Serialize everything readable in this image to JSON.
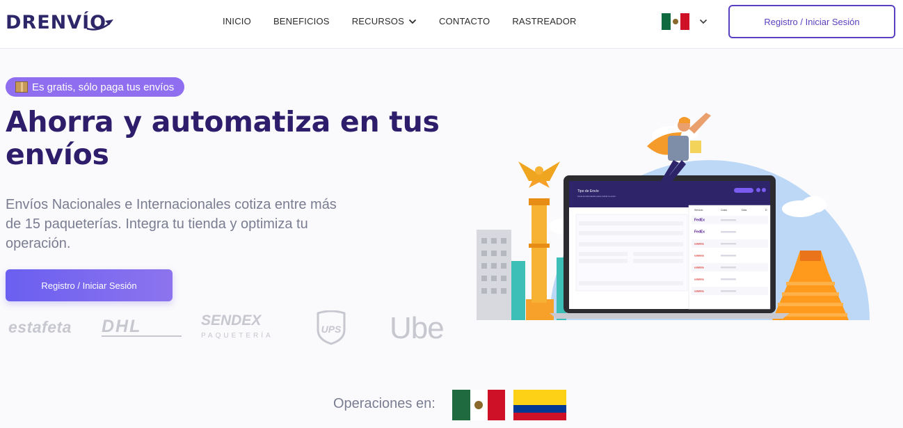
{
  "header": {
    "logo": "DRENVÍO",
    "nav": [
      {
        "label": "INICIO"
      },
      {
        "label": "BENEFICIOS"
      },
      {
        "label": "RECURSOS"
      },
      {
        "label": "CONTACTO"
      },
      {
        "label": "RASTREADOR"
      }
    ],
    "country_flag": "mexico-flag",
    "cta_label": "Registro / Iniciar Sesión"
  },
  "hero": {
    "badge": "Es gratis, sólo paga tus envíos",
    "title": "Ahorra y automatiza en tus envíos",
    "subtitle": "Envíos Nacionales e Internacionales cotiza entre más de 15 paqueterías. Integra tu tienda y optimiza tu operación.",
    "cta_label": "Registro / Iniciar Sesión"
  },
  "carriers": [
    "estafeta",
    "DHL",
    "SENDEX",
    "PAQUETERÍA",
    "UPS",
    "Ube"
  ],
  "operations": {
    "label": "Operaciones en:",
    "flags": [
      "mexico-flag",
      "colombia-flag"
    ]
  },
  "mockup": {
    "panel_title": "Tipo de Envío",
    "panel_subtitle": "Llena la información para cotizar tu envío",
    "table_headers": [
      "Servicio",
      "Costo",
      "Días",
      "D"
    ],
    "rows": [
      {
        "carrier": "FedEx",
        "color": "#4d148c"
      },
      {
        "carrier": "FedEx",
        "color": "#4d148c"
      },
      {
        "carrier": "estafeta",
        "color": "#d8312b"
      },
      {
        "carrier": "estafeta",
        "color": "#d8312b"
      },
      {
        "carrier": "estafeta",
        "color": "#d8312b"
      },
      {
        "carrier": "estafeta",
        "color": "#d8312b"
      },
      {
        "carrier": "estafeta",
        "color": "#d8312b"
      }
    ]
  },
  "colors": {
    "brand": "#2d1d6b",
    "accent": "#5a3fc0",
    "badge": "#8f6ef0",
    "muted": "#7a7d91"
  }
}
